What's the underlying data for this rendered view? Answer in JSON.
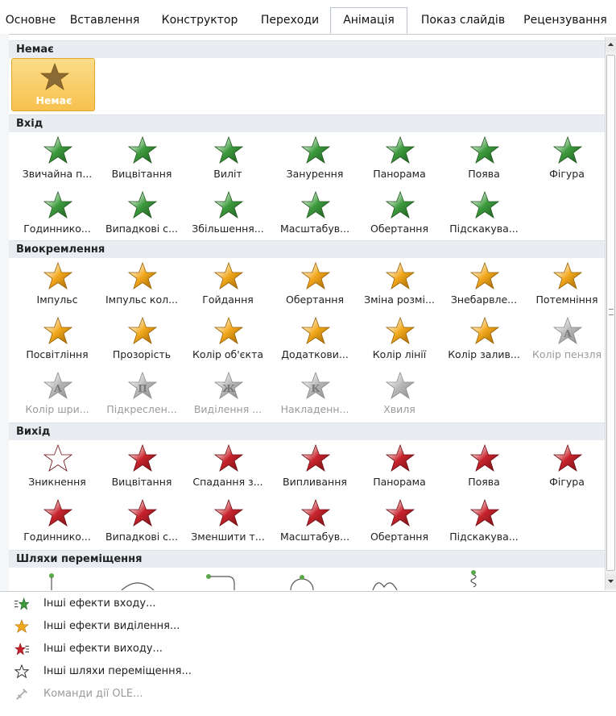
{
  "tabs": [
    {
      "label": "Основне",
      "active": false
    },
    {
      "label": "Вставлення",
      "active": false
    },
    {
      "label": "Конструктор",
      "active": false
    },
    {
      "label": "Переходи",
      "active": false
    },
    {
      "label": "Анімація",
      "active": true
    },
    {
      "label": "Показ слайдів",
      "active": false
    },
    {
      "label": "Рецензування",
      "active": false
    }
  ],
  "sections": {
    "none": {
      "title": "Немає",
      "items": [
        {
          "label": "Немає",
          "icon": "none-star-icon",
          "selected": true
        }
      ]
    },
    "entrance": {
      "title": "Вхід",
      "items": [
        {
          "label": "Звичайна п...",
          "icon": "appear-star-icon"
        },
        {
          "label": "Вицвітання",
          "icon": "fade-star-icon"
        },
        {
          "label": "Виліт",
          "icon": "fly-in-star-icon"
        },
        {
          "label": "Занурення",
          "icon": "float-in-star-icon"
        },
        {
          "label": "Панорама",
          "icon": "split-star-icon"
        },
        {
          "label": "Поява",
          "icon": "wipe-star-icon"
        },
        {
          "label": "Фігура",
          "icon": "shape-star-icon"
        },
        {
          "label": "Годиннико...",
          "icon": "wheel-star-icon"
        },
        {
          "label": "Випадкові с...",
          "icon": "random-bars-star-icon"
        },
        {
          "label": "Збільшення...",
          "icon": "grow-turn-star-icon"
        },
        {
          "label": "Масштабув...",
          "icon": "zoom-star-icon"
        },
        {
          "label": "Обертання",
          "icon": "swivel-star-icon"
        },
        {
          "label": "Підскакува...",
          "icon": "bounce-star-icon"
        }
      ]
    },
    "emphasis": {
      "title": "Виокремлення",
      "items": [
        {
          "label": "Імпульс",
          "icon": "pulse-star-icon",
          "disabled": false
        },
        {
          "label": "Імпульс кол...",
          "icon": "color-pulse-star-icon",
          "disabled": false
        },
        {
          "label": "Гойдання",
          "icon": "teeter-star-icon",
          "disabled": false
        },
        {
          "label": "Обертання",
          "icon": "spin-star-icon",
          "disabled": false
        },
        {
          "label": "Зміна розмі...",
          "icon": "grow-shrink-star-icon",
          "disabled": false
        },
        {
          "label": "Знебарвле...",
          "icon": "desaturate-star-icon",
          "disabled": false
        },
        {
          "label": "Потемніння",
          "icon": "darken-star-icon",
          "disabled": false
        },
        {
          "label": "Посвітління",
          "icon": "lighten-star-icon",
          "disabled": false
        },
        {
          "label": "Прозорість",
          "icon": "transparency-star-icon",
          "disabled": false
        },
        {
          "label": "Колір об'єкта",
          "icon": "object-color-star-icon",
          "disabled": false
        },
        {
          "label": "Додаткови...",
          "icon": "complementary-color-star-icon",
          "disabled": false
        },
        {
          "label": "Колір лінії",
          "icon": "line-color-star-icon",
          "disabled": false
        },
        {
          "label": "Колір залив...",
          "icon": "fill-color-star-icon",
          "disabled": false
        },
        {
          "label": "Колір пензля",
          "icon": "brush-color-star-icon",
          "disabled": true,
          "glyph": "A"
        },
        {
          "label": "Колір шри...",
          "icon": "font-color-star-icon",
          "disabled": true,
          "glyph": "A"
        },
        {
          "label": "Підкреслен...",
          "icon": "underline-star-icon",
          "disabled": true,
          "glyph": "П"
        },
        {
          "label": "Виділення ...",
          "icon": "bold-flash-star-icon",
          "disabled": true,
          "glyph": "Ж"
        },
        {
          "label": "Накладенн...",
          "icon": "bold-reveal-star-icon",
          "disabled": true,
          "glyph": "К"
        },
        {
          "label": "Хвиля",
          "icon": "wave-star-icon",
          "disabled": true
        }
      ]
    },
    "exit": {
      "title": "Вихід",
      "items": [
        {
          "label": "Зникнення",
          "icon": "disappear-star-icon"
        },
        {
          "label": "Вицвітання",
          "icon": "fade-out-star-icon"
        },
        {
          "label": "Спадання з...",
          "icon": "fly-out-star-icon"
        },
        {
          "label": "Випливання",
          "icon": "float-out-star-icon"
        },
        {
          "label": "Панорама",
          "icon": "split-out-star-icon"
        },
        {
          "label": "Поява",
          "icon": "wipe-out-star-icon"
        },
        {
          "label": "Фігура",
          "icon": "shape-out-star-icon"
        },
        {
          "label": "Годиннико...",
          "icon": "wheel-out-star-icon"
        },
        {
          "label": "Випадкові с...",
          "icon": "random-bars-out-star-icon"
        },
        {
          "label": "Зменшити т...",
          "icon": "shrink-turn-star-icon"
        },
        {
          "label": "Масштабув...",
          "icon": "zoom-out-star-icon"
        },
        {
          "label": "Обертання",
          "icon": "swivel-out-star-icon"
        },
        {
          "label": "Підскакува...",
          "icon": "bounce-out-star-icon"
        }
      ]
    },
    "motion": {
      "title": "Шляхи переміщення"
    }
  },
  "menu": [
    {
      "label": "Інші ефекти входу...",
      "icon": "more-entrance-effects-icon",
      "disabled": false
    },
    {
      "label": "Інші ефекти виділення...",
      "icon": "more-emphasis-effects-icon",
      "disabled": false
    },
    {
      "label": "Інші ефекти виходу...",
      "icon": "more-exit-effects-icon",
      "disabled": false
    },
    {
      "label": "Інші шляхи переміщення...",
      "icon": "more-motion-paths-icon",
      "disabled": false
    },
    {
      "label": "Команди дії OLE...",
      "icon": "ole-action-verbs-icon",
      "disabled": true
    }
  ],
  "colors": {
    "green": "#3c9a3c",
    "gold": "#f2a81d",
    "red": "#c8232c",
    "gray": "#b8b8b8",
    "selected": "#f7c14d"
  }
}
